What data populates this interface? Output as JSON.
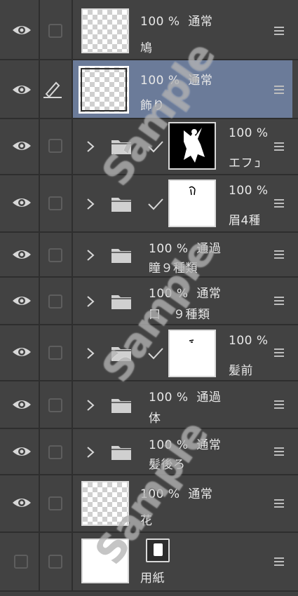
{
  "layers": [
    {
      "opacity": "100 %",
      "blend": "通常",
      "name": "鳩",
      "kind": "raster"
    },
    {
      "opacity": "100 %",
      "blend": "通常",
      "name": "飾り",
      "kind": "raster"
    },
    {
      "opacity": "100 %",
      "name": "エフェ",
      "kind": "folder-masked",
      "thumb": "black"
    },
    {
      "opacity": "100 %",
      "name": "眉4種",
      "kind": "folder-masked",
      "thumb": "white"
    },
    {
      "opacity": "100 %",
      "blend": "通過",
      "name": "瞳９種類",
      "kind": "folder"
    },
    {
      "opacity": "100 %",
      "blend": "通常",
      "name": "口　９種類",
      "kind": "folder"
    },
    {
      "opacity": "100 %",
      "name": "髪前",
      "kind": "folder-masked",
      "thumb": "white"
    },
    {
      "opacity": "100 %",
      "blend": "通過",
      "name": "体",
      "kind": "folder"
    },
    {
      "opacity": "100 %",
      "blend": "通常",
      "name": "髪後ろ",
      "kind": "folder"
    },
    {
      "opacity": "100 %",
      "blend": "通常",
      "name": "花",
      "kind": "raster"
    },
    {
      "name": "用紙",
      "kind": "paper"
    }
  ],
  "watermark": "Sample",
  "icons": {
    "visibility": "eye-icon",
    "edit": "pen-icon",
    "expand": "chevron-right-icon",
    "folder": "folder-icon",
    "mask_link": "checkmark-icon",
    "menu": "menu-icon",
    "paper": "paper-icon"
  },
  "colors": {
    "panel_bg": "#424242",
    "selected_bg": "#6b7b99",
    "divider": "#2e2e2e"
  }
}
